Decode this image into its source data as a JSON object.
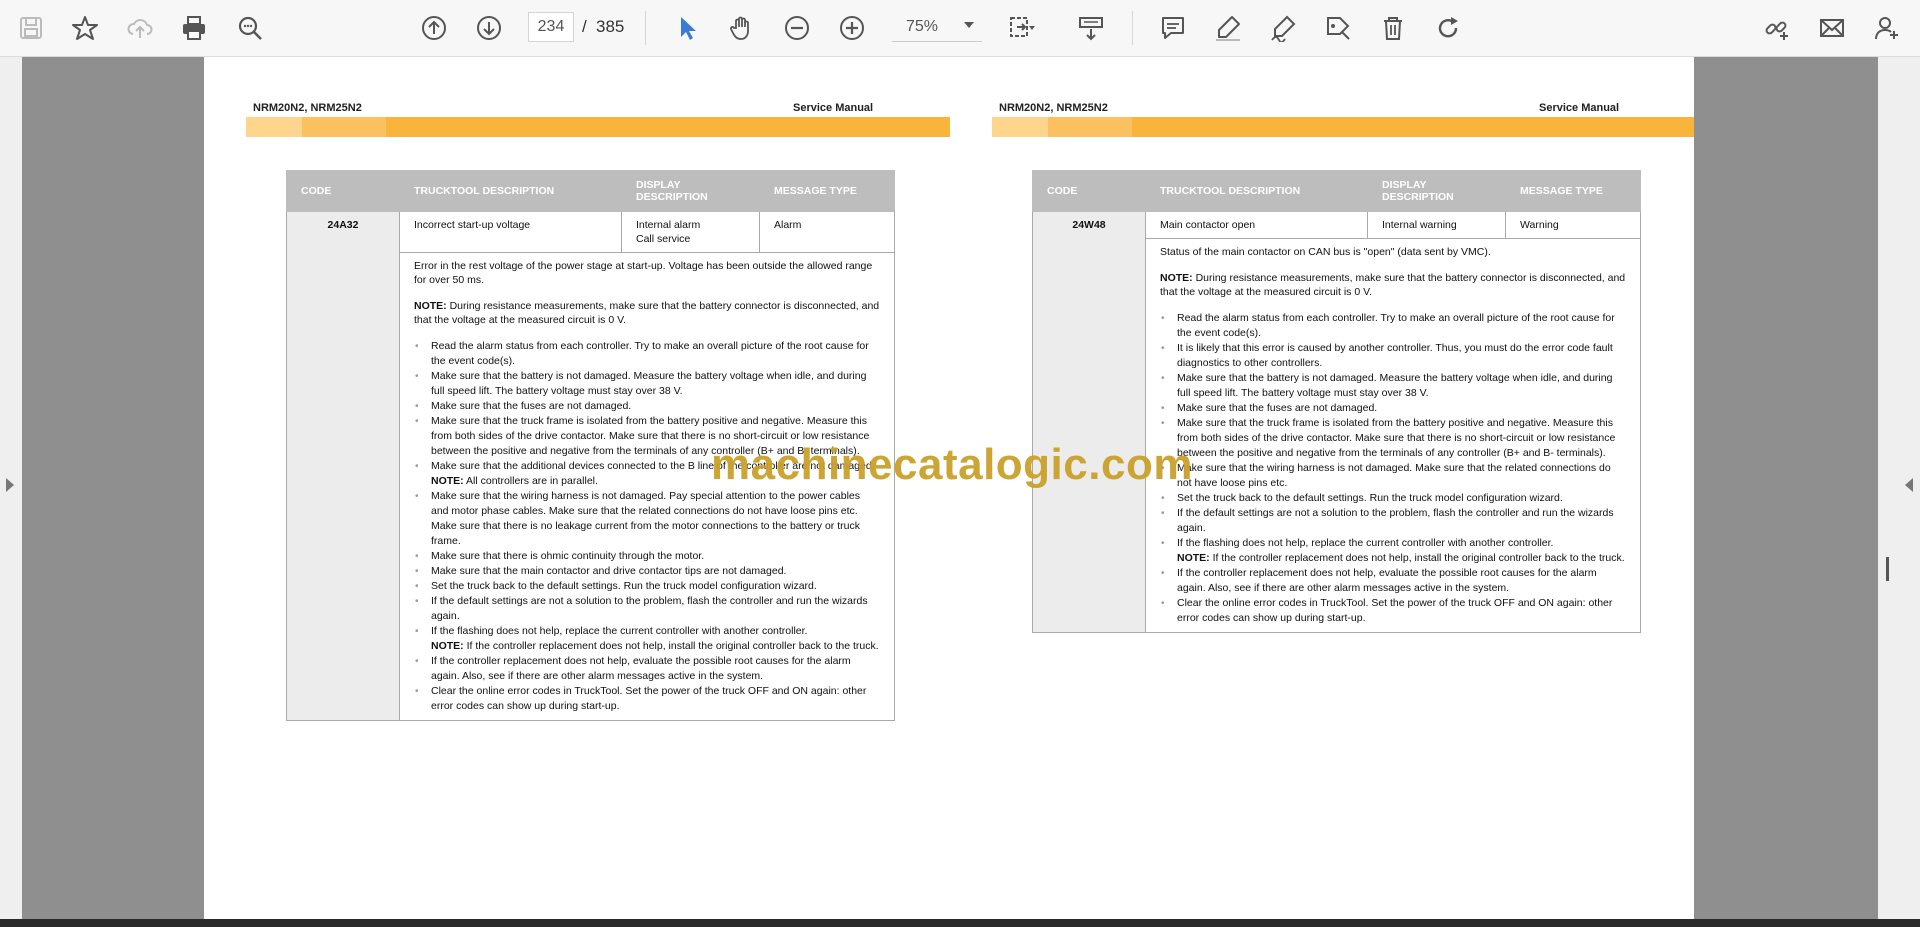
{
  "toolbar": {
    "page_current": "234",
    "page_separator": "/",
    "page_total": "385",
    "zoom_value": "75%",
    "buttons": [
      "save-icon",
      "bookmark-star-icon",
      "upload-cloud-icon",
      "print-icon",
      "search-zoom-icon",
      "page-up-icon",
      "page-down-icon",
      "select-cursor-icon",
      "hand-tool-icon",
      "zoom-out-icon",
      "zoom-in-icon",
      "fit-page-icon",
      "scroll-mode-icon",
      "comment-icon",
      "highlight-pen-icon",
      "sign-pen-icon",
      "edit-tag-icon",
      "delete-icon",
      "rotate-icon",
      "share-link-icon",
      "email-icon",
      "add-user-icon"
    ]
  },
  "colors": {
    "accent": "#3a7bd5",
    "band_light": "#fdd58d",
    "band_mid": "#fbc161",
    "band_dark": "#f9b43c",
    "header_gray": "#bdbdbd",
    "watermark": "#caa12a"
  },
  "watermark": "machinecatalogic.com",
  "pages": [
    {
      "header_left": "NRM20N2, NRM25N2",
      "header_right": "Service Manual",
      "columns": [
        "CODE",
        "TRUCKTOOL DESCRIPTION",
        "DISPLAY DESCRIPTION",
        "MESSAGE TYPE"
      ],
      "code": "24A32",
      "trucktool_description": "Incorrect start-up voltage",
      "display_description_1": "Internal alarm",
      "display_description_2": "Call service",
      "message_type": "Alarm",
      "intro": "Error in the rest voltage of the power stage at start-up. Voltage has been outside the allowed range for over 50 ms.",
      "note_label": "NOTE:",
      "note_text": "During resistance measurements, make sure that the battery connector is disconnected, and that the voltage at the measured circuit is 0 V.",
      "items": [
        {
          "text": "Read the alarm status from each controller. Try to make an overall picture of the root cause for the event code(s)."
        },
        {
          "text": "Make sure that the battery is not damaged. Measure the battery voltage when idle, and during full speed lift. The battery voltage must stay over 38 V."
        },
        {
          "text": "Make sure that the fuses are not damaged."
        },
        {
          "text": "Make sure that the truck frame is isolated from the battery positive and negative. Measure this from both sides of the drive contactor. Make sure that there is no short-circuit or low resistance between the positive and negative from the terminals of any controller (B+ and B- terminals)."
        },
        {
          "text": "Make sure that the additional devices connected to the B line of the controller are not damaged.",
          "note_label": "NOTE:",
          "note": "All controllers are in parallel."
        },
        {
          "text": "Make sure that the wiring harness is not damaged. Pay special attention to the power cables and motor phase cables. Make sure that the related connections do not have loose pins etc. Make sure that there is no leakage current from the motor connections to the battery or truck frame."
        },
        {
          "text": "Make sure that there is ohmic continuity through the motor."
        },
        {
          "text": "Make sure that the main contactor and drive contactor tips are not damaged."
        },
        {
          "text": "Set the truck back to the default settings. Run the truck model configuration wizard."
        },
        {
          "text": "If the default settings are not a solution to the problem, flash the controller and run the wizards again."
        },
        {
          "text": "If the flashing does not help, replace the current controller with another controller.",
          "note_label": "NOTE:",
          "note": "If the controller replacement does not help, install the original controller back to the truck."
        },
        {
          "text": "If the controller replacement does not help, evaluate the possible root causes for the alarm again. Also, see if there are other alarm messages active in the system."
        },
        {
          "text": "Clear the online error codes in TruckTool. Set the power of the truck OFF and ON again: other error codes can show up during start-up."
        }
      ]
    },
    {
      "header_left": "NRM20N2, NRM25N2",
      "header_right": "Service Manual",
      "columns": [
        "CODE",
        "TRUCKTOOL DESCRIPTION",
        "DISPLAY DESCRIPTION",
        "MESSAGE TYPE"
      ],
      "code": "24W48",
      "trucktool_description": "Main contactor open",
      "display_description_1": "Internal warning",
      "display_description_2": "",
      "message_type": "Warning",
      "intro": "Status of the main contactor on CAN bus is \"open\" (data sent by VMC).",
      "note_label": "NOTE:",
      "note_text": "During resistance measurements, make sure that the battery connector is disconnected, and that the voltage at the measured circuit is 0 V.",
      "items": [
        {
          "text": "Read the alarm status from each controller. Try to make an overall picture of the root cause for the event code(s)."
        },
        {
          "text": "It is likely that this error is caused by another controller. Thus, you must do the error code fault diagnostics to other controllers."
        },
        {
          "text": "Make sure that the battery is not damaged. Measure the battery voltage when idle, and during full speed lift. The battery voltage must stay over 38 V."
        },
        {
          "text": "Make sure that the fuses are not damaged."
        },
        {
          "text": "Make sure that the truck frame is isolated from the battery positive and negative. Measure this from both sides of the drive contactor. Make sure that there is no short-circuit or low resistance between the positive and negative from the terminals of any controller (B+ and B- terminals)."
        },
        {
          "text": "Make sure that the wiring harness is not damaged. Make sure that the related connections do not have loose pins etc."
        },
        {
          "text": "Set the truck back to the default settings. Run the truck model configuration wizard."
        },
        {
          "text": "If the default settings are not a solution to the problem, flash the controller and run the wizards again."
        },
        {
          "text": "If the flashing does not help, replace the current controller with another controller.",
          "note_label": "NOTE:",
          "note": "If the controller replacement does not help, install the original controller back to the truck."
        },
        {
          "text": "If the controller replacement does not help, evaluate the possible root causes for the alarm again. Also, see if there are other alarm messages active in the system."
        },
        {
          "text": "Clear the online error codes in TruckTool. Set the power of the truck OFF and ON again: other error codes can show up during start-up."
        }
      ]
    }
  ]
}
